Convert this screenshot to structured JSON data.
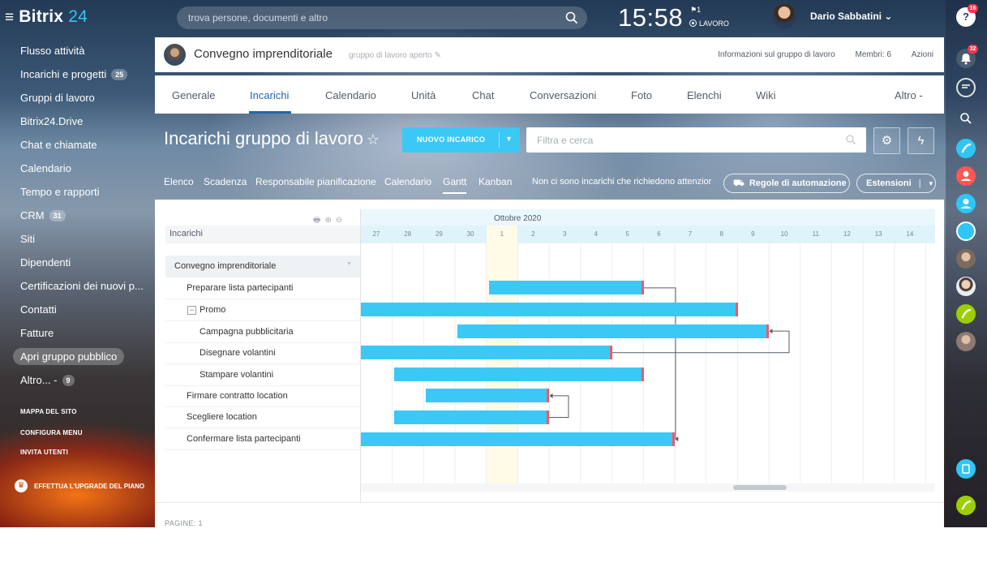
{
  "app": {
    "brand": "Bitrix",
    "brand_num": "24"
  },
  "sidebar": {
    "items": [
      {
        "label": "Flusso attività",
        "count": ""
      },
      {
        "label": "Incarichi e progetti",
        "count": "25"
      },
      {
        "label": "Gruppi di lavoro",
        "count": ""
      },
      {
        "label": "Bitrix24.Drive",
        "count": ""
      },
      {
        "label": "Chat e chiamate",
        "count": ""
      },
      {
        "label": "Calendario",
        "count": ""
      },
      {
        "label": "Tempo e rapporti",
        "count": ""
      },
      {
        "label": "CRM",
        "count": "31"
      },
      {
        "label": "Siti",
        "count": ""
      },
      {
        "label": "Dipendenti",
        "count": ""
      },
      {
        "label": "Certificazioni dei nuovi p...",
        "count": ""
      },
      {
        "label": "Contatti",
        "count": ""
      },
      {
        "label": "Fatture",
        "count": ""
      },
      {
        "label": "Apri gruppo pubblico",
        "count": ""
      },
      {
        "label": "Altro... -",
        "count": "9"
      }
    ],
    "small_links": [
      "MAPPA DEL SITO",
      "CONFIGURA MENU",
      "INVITA UTENTI"
    ],
    "upgrade": "EFFETTUA L'UPGRADE DEL PIANO"
  },
  "header": {
    "search_placeholder": "trova persone, documenti e altro",
    "time": "15:58",
    "flag_count": "1",
    "work_status": "LAVORO",
    "user_name": "Dario Sabbatini",
    "user_caret": "⌄"
  },
  "rightbar": {
    "help_badge": "16",
    "notif_badge": "32"
  },
  "group": {
    "title": "Convegno imprenditoriale",
    "subtitle": "gruppo di lavoro aperto",
    "info_link": "Informazioni sul gruppo di lavoro",
    "members": "Membri: 6",
    "actions": "Azioni"
  },
  "tabs": [
    "Generale",
    "Incarichi",
    "Calendario",
    "Unità",
    "Chat",
    "Conversazioni",
    "Foto",
    "Elenchi",
    "Wiki",
    "Altro -"
  ],
  "page": {
    "title": "Incarichi gruppo di lavoro",
    "star": "☆",
    "new_task": "NUOVO INCARICO",
    "filter_placeholder": "Filtra e cerca"
  },
  "subnav": {
    "items": [
      "Elenco",
      "Scadenza",
      "Responsabile pianificazione",
      "Calendario",
      "Gantt",
      "Kanban"
    ],
    "note": "Non ci sono incarichi che richiedono attenzior",
    "automation": "Regole di automazione",
    "extensions": "Estensioni"
  },
  "gantt": {
    "column_header": "Incarichi",
    "month": "Ottobre 2020",
    "days": [
      "27",
      "28",
      "29",
      "30",
      "1",
      "2",
      "3",
      "4",
      "5",
      "6",
      "7",
      "8",
      "9",
      "10",
      "11",
      "12",
      "13",
      "14"
    ],
    "today": "1",
    "tasks": [
      {
        "name": "Convegno imprenditoriale",
        "group": true,
        "start": null,
        "end": null
      },
      {
        "name": "Preparare lista partecipanti",
        "start": "2020-10-01",
        "end": "2020-10-05"
      },
      {
        "name": "Promo",
        "collapsible": true,
        "start": "2020-09-27",
        "end": "2020-10-08"
      },
      {
        "name": "Campagna pubblicitaria",
        "start": "2020-09-30",
        "end": "2020-10-09"
      },
      {
        "name": "Disegnare volantini",
        "start": "2020-09-27",
        "end": "2020-10-04"
      },
      {
        "name": "Stampare volantini",
        "start": "2020-09-28",
        "end": "2020-10-05"
      },
      {
        "name": "Firmare contratto location",
        "start": "2020-09-29",
        "end": "2020-10-02"
      },
      {
        "name": "Scegliere location",
        "start": "2020-09-28",
        "end": "2020-10-02"
      },
      {
        "name": "Confermare lista partecipanti",
        "start": "2020-09-27",
        "end": "2020-10-06"
      }
    ]
  },
  "footer": {
    "pages": "PAGINE: 1"
  },
  "colors": {
    "accent": "#2067b0",
    "bar": "#3bc8f5",
    "bar_end": "#ee5a62",
    "badge": "#f2364c"
  }
}
